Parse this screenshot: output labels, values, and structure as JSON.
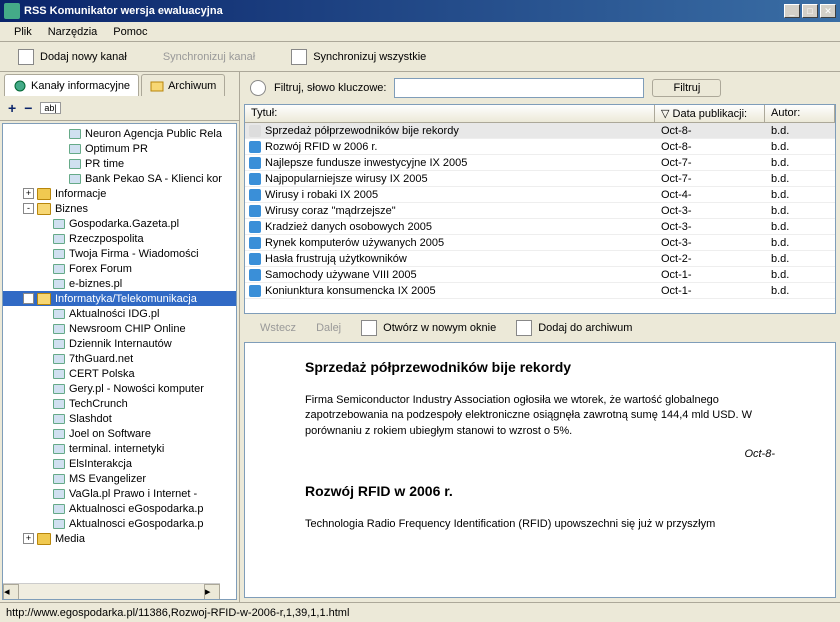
{
  "window": {
    "title": "RSS Komunikator wersja ewaluacyjna"
  },
  "menu": {
    "file": "Plik",
    "tools": "Narzędzia",
    "help": "Pomoc"
  },
  "toolbar": {
    "add": "Dodaj nowy kanał",
    "sync": "Synchronizuj kanał",
    "syncall": "Synchronizuj wszystkie"
  },
  "tabs": {
    "channels": "Kanały informacyjne",
    "archive": "Archiwum"
  },
  "tree": {
    "top": [
      {
        "label": "Neuron Agencja Public Rela"
      },
      {
        "label": "Optimum PR"
      },
      {
        "label": "PR time"
      },
      {
        "label": "Bank Pekao SA - Klienci kor"
      }
    ],
    "folders": [
      {
        "label": "Informacje",
        "state": "+",
        "children": []
      },
      {
        "label": "Biznes",
        "state": "-",
        "children": [
          {
            "label": "Gospodarka.Gazeta.pl"
          },
          {
            "label": "Rzeczpospolita"
          },
          {
            "label": "Twoja Firma - Wiadomości"
          },
          {
            "label": "Forex Forum"
          },
          {
            "label": "e-biznes.pl"
          }
        ]
      },
      {
        "label": "Informatyka/Telekomunikacja",
        "state": "-",
        "selected": true,
        "children": [
          {
            "label": "Aktualności IDG.pl"
          },
          {
            "label": "Newsroom CHIP Online"
          },
          {
            "label": "Dziennik Internautów"
          },
          {
            "label": "7thGuard.net"
          },
          {
            "label": "CERT Polska"
          },
          {
            "label": "Gery.pl - Nowości komputer"
          },
          {
            "label": "TechCrunch"
          },
          {
            "label": "Slashdot"
          },
          {
            "label": "Joel on Software"
          },
          {
            "label": "terminal. internetyki"
          },
          {
            "label": "ElsInterakcja"
          },
          {
            "label": "MS Evangelizer"
          },
          {
            "label": "VaGla.pl Prawo i Internet -"
          },
          {
            "label": "Aktualnosci eGospodarka.p"
          },
          {
            "label": "Aktualnosci eGospodarka.p"
          }
        ]
      },
      {
        "label": "Media",
        "state": "+",
        "children": []
      }
    ]
  },
  "filter": {
    "label": "Filtruj, słowo kluczowe:",
    "button": "Filtruj",
    "value": ""
  },
  "grid": {
    "cols": {
      "title": "Tytuł:",
      "date": "Data publikacji:",
      "author": "Autor:"
    },
    "rows": [
      {
        "t": "Sprzedaż półprzewodników bije rekordy",
        "d": "Oct-8-",
        "a": "b.d.",
        "sel": true
      },
      {
        "t": "Rozwój RFID w 2006 r.",
        "d": "Oct-8-",
        "a": "b.d."
      },
      {
        "t": "Najlepsze fundusze inwestycyjne IX 2005",
        "d": "Oct-7-",
        "a": "b.d."
      },
      {
        "t": "Najpopularniejsze wirusy IX 2005",
        "d": "Oct-7-",
        "a": "b.d."
      },
      {
        "t": "Wirusy i robaki IX 2005",
        "d": "Oct-4-",
        "a": "b.d."
      },
      {
        "t": "Wirusy coraz \"mądrzejsze\"",
        "d": "Oct-3-",
        "a": "b.d."
      },
      {
        "t": "Kradzież danych osobowych 2005",
        "d": "Oct-3-",
        "a": "b.d."
      },
      {
        "t": "Rynek komputerów używanych 2005",
        "d": "Oct-3-",
        "a": "b.d."
      },
      {
        "t": "Hasła frustrują użytkowników",
        "d": "Oct-2-",
        "a": "b.d."
      },
      {
        "t": "Samochody używane VIII 2005",
        "d": "Oct-1-",
        "a": "b.d."
      },
      {
        "t": "Koniunktura konsumencka IX 2005",
        "d": "Oct-1-",
        "a": "b.d."
      }
    ]
  },
  "nav": {
    "back": "Wstecz",
    "fwd": "Dalej",
    "open": "Otwórz w nowym oknie",
    "archive": "Dodaj do archiwum"
  },
  "preview": {
    "h1": "Sprzedaż półprzewodników bije rekordy",
    "p1": "Firma Semiconductor Industry Association ogłosiła we wtorek, że wartość globalnego zapotrzebowania na podzespoły elektroniczne osiągnęła zawrotną sumę 144,4 mld USD. W porównaniu z rokiem ubiegłym stanowi to wzrost o 5%.",
    "d1": "Oct-8-",
    "h2": "Rozwój RFID w 2006 r.",
    "p2": "Technologia Radio Frequency Identification (RFID) upowszechni się już w przyszłym"
  },
  "status": {
    "text": "http://www.egospodarka.pl/11386,Rozwoj-RFID-w-2006-r,1,39,1,1.html"
  }
}
